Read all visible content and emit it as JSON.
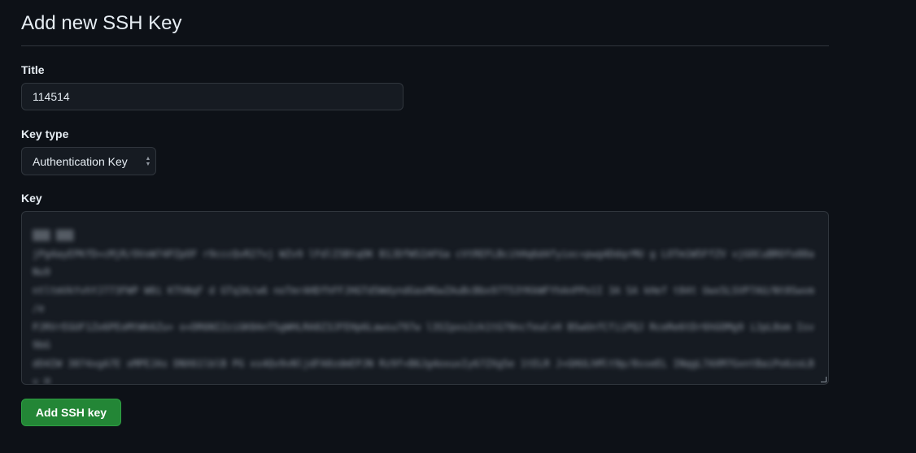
{
  "page": {
    "title": "Add new SSH Key"
  },
  "form": {
    "title_label": "Title",
    "title_value": "114514",
    "key_type_label": "Key type",
    "key_type_value": "Authentication Key",
    "key_label": "Key",
    "submit_label": "Add SSH key"
  },
  "colors": {
    "background": "#0d1117",
    "input_bg": "#161b22",
    "border": "#30363d",
    "primary_button": "#238636"
  },
  "icons": {
    "select_arrows": "chevron-up-down-icon"
  }
}
